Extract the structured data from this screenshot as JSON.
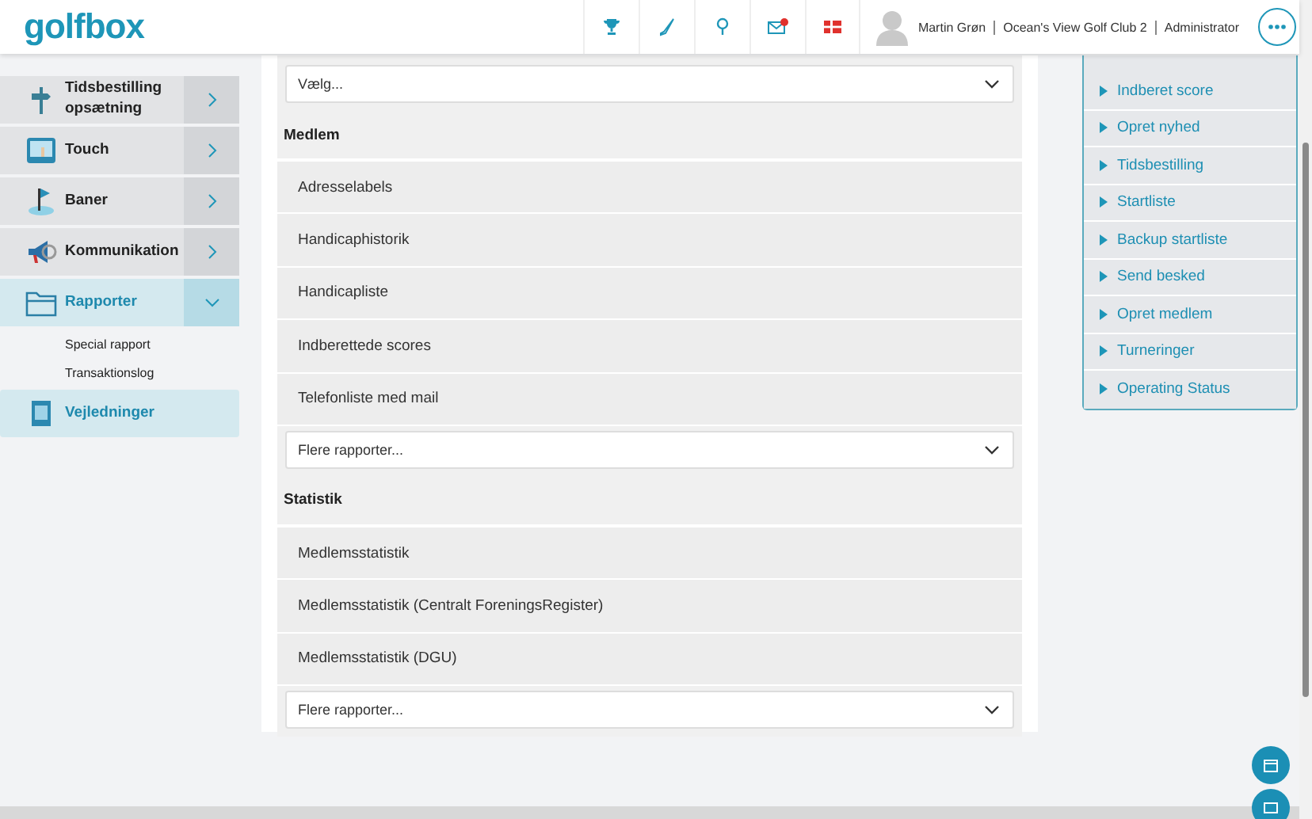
{
  "header": {
    "logo": "golfbox",
    "user": {
      "name": "Martin Grøn",
      "club": "Ocean's View Golf Club 2",
      "role": "Administrator"
    },
    "notification": true
  },
  "sidebar": {
    "items": [
      {
        "kind": "menu",
        "label": "Tidsbestilling opsætning",
        "selected": false,
        "expanded": false
      },
      {
        "kind": "menu",
        "label": "Touch",
        "selected": false,
        "expanded": false
      },
      {
        "kind": "menu",
        "label": "Baner",
        "selected": false,
        "expanded": false
      },
      {
        "kind": "menu",
        "label": "Kommunikation",
        "selected": false,
        "expanded": false
      },
      {
        "kind": "menu",
        "label": "Rapporter",
        "selected": true,
        "expanded": true,
        "children": [
          {
            "label": "Special rapport"
          },
          {
            "label": "Transaktionslog"
          }
        ]
      },
      {
        "kind": "link",
        "label": "Vejledninger"
      }
    ]
  },
  "reports": {
    "top_select": "Vælg...",
    "sections": [
      {
        "title": "Medlem",
        "reports": [
          "Adresselabels",
          "Handicaphistorik",
          "Handicapliste",
          "Indberettede scores",
          "Telefonliste med mail"
        ],
        "more_select": "Flere rapporter..."
      },
      {
        "title": "Statistik",
        "reports": [
          "Medlemsstatistik",
          "Medlemsstatistik (Centralt ForeningsRegister)",
          "Medlemsstatistik (DGU)"
        ],
        "more_select": "Flere rapporter..."
      }
    ]
  },
  "quick_links": [
    "Indberet score",
    "Opret nyhed",
    "Tidsbestilling",
    "Startliste",
    "Backup startliste",
    "Send besked",
    "Opret medlem",
    "Turneringer",
    "Operating Status"
  ]
}
